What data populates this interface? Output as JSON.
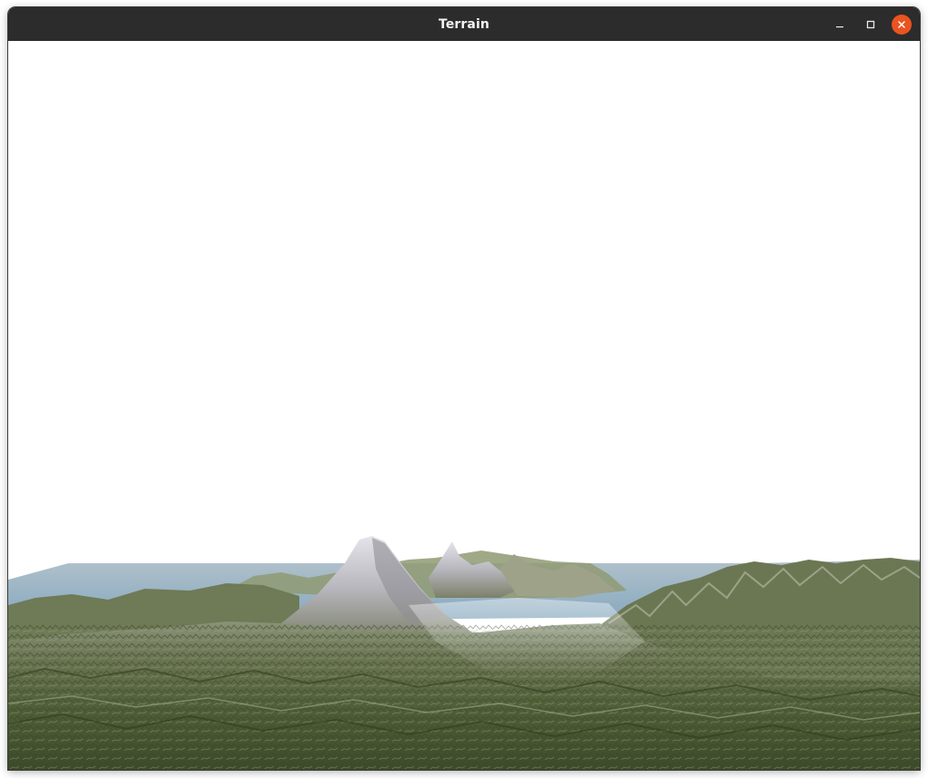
{
  "window": {
    "title": "Terrain",
    "controls": {
      "minimize_icon": "minimize-icon",
      "maximize_icon": "maximize-icon",
      "close_icon": "close-icon"
    },
    "colors": {
      "titlebar": "#2c2c2c",
      "close_button": "#e95420",
      "title_text": "#f2f2f2"
    }
  },
  "scene": {
    "sky_color": "#ffffff",
    "water_color": "#5f9bbd",
    "vegetation_color": "#5d6e45",
    "rock_color": "#b9b8bf"
  }
}
